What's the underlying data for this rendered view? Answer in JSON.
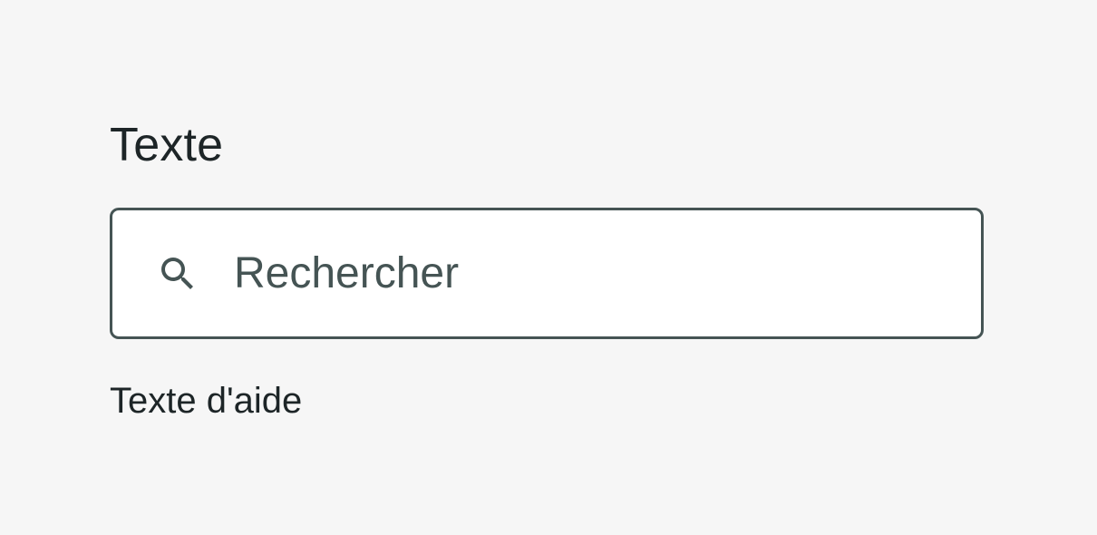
{
  "field": {
    "label": "Texte",
    "placeholder": "Rechercher",
    "value": "",
    "helper_text": "Texte d'aide",
    "icon": "search-icon"
  },
  "colors": {
    "background": "#f6f6f6",
    "label_text": "#1d2527",
    "border": "#455454",
    "input_bg": "#ffffff",
    "placeholder": "#455454"
  }
}
